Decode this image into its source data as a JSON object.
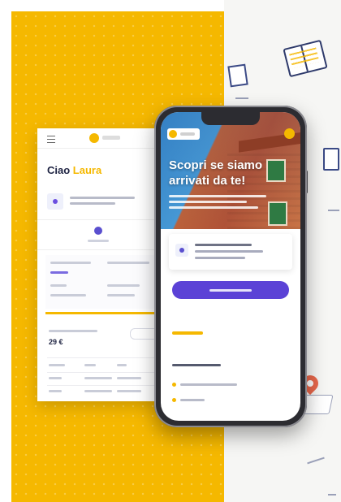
{
  "desktop": {
    "greeting": "Ciao",
    "name": "Laura",
    "price": "29 €"
  },
  "phone": {
    "hero_title": "Scopri se siamo arrivati da te!"
  },
  "colors": {
    "brand_yellow": "#f5b800",
    "accent_purple": "#5b42d6",
    "text_dark": "#1e2342"
  }
}
